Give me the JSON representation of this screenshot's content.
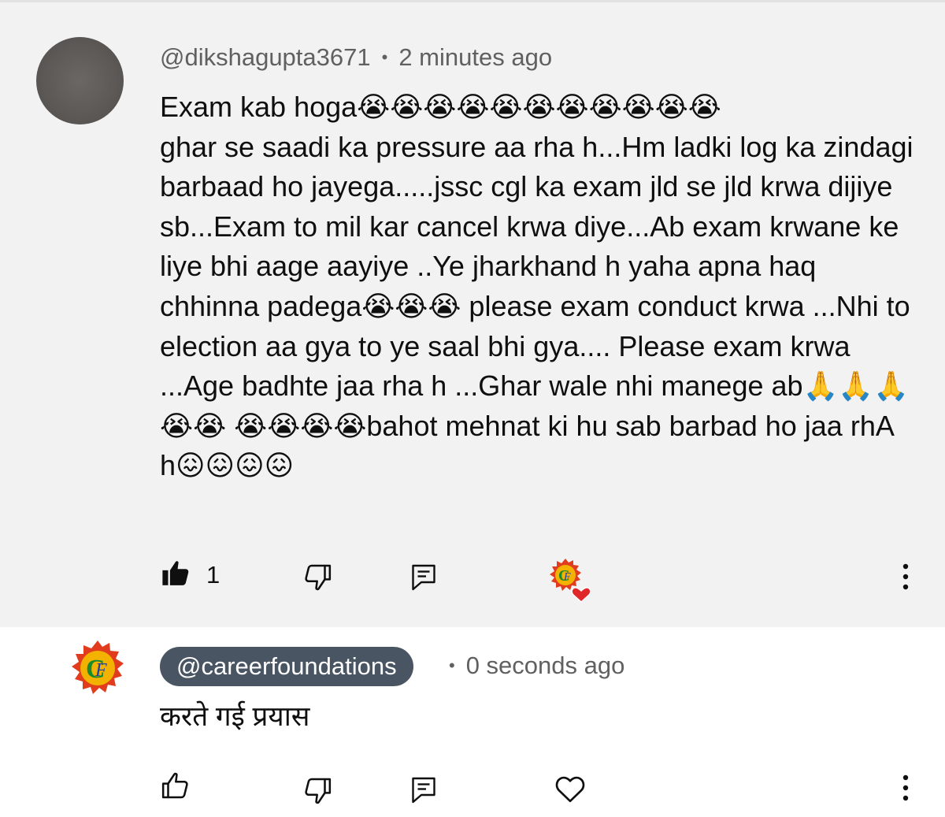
{
  "comment": {
    "author": "@dikshagupta3671",
    "separator": "•",
    "time": "2 minutes ago",
    "text": "Exam kab hoga😭😭😭😭😭😭😭😭😭😭😭\nghar se saadi ka pressure aa rha h...Hm ladki log ka zindagi barbaad ho jayega.....jssc cgl ka exam jld se jld krwa dijiye sb...Exam to mil kar cancel krwa diye...Ab exam krwane ke liye bhi aage aayiye ..Ye jharkhand h yaha apna haq chhinna padega😭😭😭 please exam conduct krwa ...Nhi to election aa gya to ye saal bhi gya.... Please exam krwa ...Age badhte jaa rha h ...Ghar wale nhi manege ab🙏🙏🙏😭😭 😭😭😭😭bahot mehnat ki hu sab barbad ho jaa rhA h😖😖😖😖",
    "like_count": "1",
    "creator_heart": true,
    "icons": {
      "like": "thumbs-up-filled-icon",
      "dislike": "thumbs-down-icon",
      "reply": "reply-icon",
      "heart": "creator-heart-icon",
      "more": "more-vertical-icon"
    }
  },
  "reply": {
    "channel": "@careerfoundations",
    "separator": "•",
    "time": "0 seconds ago",
    "text": "करते गई प्रयास",
    "icons": {
      "like": "thumbs-up-icon",
      "dislike": "thumbs-down-icon",
      "reply": "reply-icon",
      "heart": "heart-outline-icon",
      "more": "more-vertical-icon"
    }
  },
  "colors": {
    "highlight_bg": "#f2f2f2",
    "chip_bg": "#495562",
    "heart": "#e02828",
    "logo_sun": "#f0a400",
    "logo_ray": "#e23c1e"
  }
}
